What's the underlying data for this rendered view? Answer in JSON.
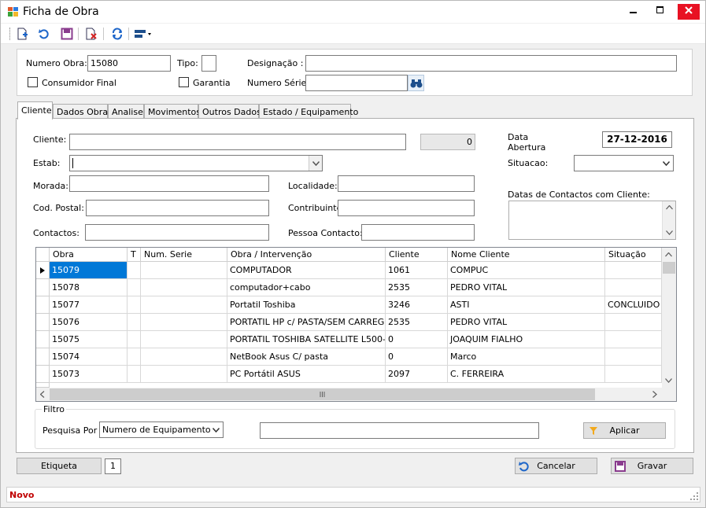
{
  "window": {
    "title": "Ficha de Obra"
  },
  "header": {
    "numero_obra_label": "Numero Obra:",
    "numero_obra_value": "15080",
    "tipo_label": "Tipo:",
    "tipo_value": "",
    "designacao_label": "Designação :",
    "designacao_value": "",
    "consumidor_final_label": "Consumidor Final",
    "garantia_label": "Garantia",
    "numero_serie_label": "Numero Série:",
    "numero_serie_value": ""
  },
  "tabs": [
    {
      "label": "Cliente",
      "active": true
    },
    {
      "label": "Dados Obra"
    },
    {
      "label": "Analise"
    },
    {
      "label": "Movimentos"
    },
    {
      "label": "Outros Dados"
    },
    {
      "label": "Estado / Equipamento"
    }
  ],
  "cliente": {
    "cliente_label": "Cliente:",
    "cliente_value": "",
    "cliente_num": "0",
    "estab_label": "Estab:",
    "estab_value": "",
    "morada_label": "Morada:",
    "morada_value": "",
    "localidade_label": "Localidade:",
    "localidade_value": "",
    "cod_postal_label": "Cod. Postal:",
    "cod_postal_value": "",
    "contribuinte_label": "Contribuinte:",
    "contribuinte_value": "",
    "contactos_label": "Contactos:",
    "contactos_value": "",
    "pessoa_contacto_label": "Pessoa Contacto:",
    "pessoa_contacto_value": "",
    "data_abertura_label_1": "Data",
    "data_abertura_label_2": "Abertura",
    "data_abertura_value": "27-12-2016",
    "situacao_label": "Situacao:",
    "situacao_value": "",
    "datas_contactos_label": "Datas de Contactos com Cliente:"
  },
  "grid": {
    "columns": [
      "Obra",
      "T",
      "Num. Serie",
      "Obra / Intervenção",
      "Cliente",
      "Nome Cliente",
      "Situação"
    ],
    "rows": [
      {
        "obra": "15079",
        "t": "",
        "num_serie": "",
        "intervencao": "COMPUTADOR",
        "cliente": "1061",
        "nome": "COMPUC",
        "situacao": ""
      },
      {
        "obra": "15078",
        "t": "",
        "num_serie": "",
        "intervencao": "computador+cabo",
        "cliente": "2535",
        "nome": "PEDRO VITAL",
        "situacao": ""
      },
      {
        "obra": "15077",
        "t": "",
        "num_serie": "",
        "intervencao": "Portatil Toshiba",
        "cliente": "3246",
        "nome": "ASTI",
        "situacao": "CONCLUIDO"
      },
      {
        "obra": "15076",
        "t": "",
        "num_serie": "",
        "intervencao": "PORTATIL HP c/ PASTA/SEM CARREG...",
        "cliente": "2535",
        "nome": "PEDRO VITAL",
        "situacao": ""
      },
      {
        "obra": "15075",
        "t": "",
        "num_serie": "",
        "intervencao": "PORTATIL TOSHIBA SATELLITE L500-...",
        "cliente": "0",
        "nome": "JOAQUIM FIALHO",
        "situacao": ""
      },
      {
        "obra": "15074",
        "t": "",
        "num_serie": "",
        "intervencao": "NetBook Asus C/ pasta",
        "cliente": "0",
        "nome": "Marco",
        "situacao": ""
      },
      {
        "obra": "15073",
        "t": "",
        "num_serie": "",
        "intervencao": "PC Portátil ASUS",
        "cliente": "2097",
        "nome": "C.    FERREIRA",
        "situacao": ""
      }
    ]
  },
  "filtro": {
    "title": "Filtro",
    "pesquisa_label": "Pesquisa Por",
    "pesquisa_value": "Numero de Equipamento",
    "search_value": "",
    "aplicar_label": "Aplicar"
  },
  "footer": {
    "etiqueta_label": "Etiqueta",
    "etiqueta_count": "1",
    "cancelar_label": "Cancelar",
    "gravar_label": "Gravar"
  },
  "status": {
    "text": "Novo",
    "color": "#c00000"
  }
}
